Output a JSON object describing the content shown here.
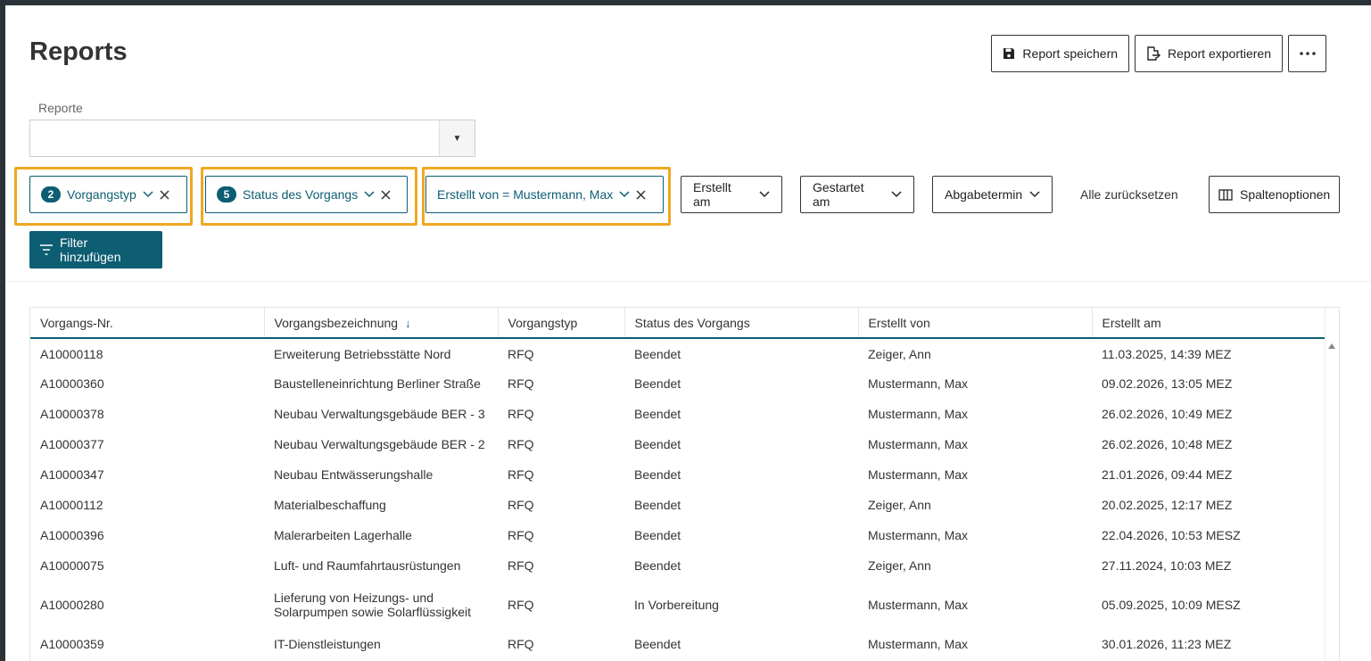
{
  "page": {
    "title": "Reports",
    "actions": {
      "save_label": "Report speichern",
      "export_label": "Report exportieren"
    }
  },
  "report_select": {
    "label": "Reporte",
    "value": ""
  },
  "filters": {
    "active": [
      {
        "count": "2",
        "label": "Vorgangstyp"
      },
      {
        "count": "5",
        "label": "Status des Vorgangs"
      },
      {
        "label": "Erstellt von = Mustermann, Max"
      }
    ],
    "inactive": [
      "Erstellt am",
      "Gestartet am",
      "Abgabetermin"
    ],
    "reset_label": "Alle zurücksetzen",
    "column_options_label": "Spaltenoptionen",
    "add_filter_label": "Filter hinzufügen"
  },
  "table": {
    "columns": [
      "Vorgangs-Nr.",
      "Vorgangsbezeichnung",
      "Vorgangstyp",
      "Status des Vorgangs",
      "Erstellt von",
      "Erstellt am"
    ],
    "sorted_column": "Vorgangsbezeichnung",
    "rows": [
      [
        "A10000118",
        "Erweiterung Betriebsstätte Nord",
        "RFQ",
        "Beendet",
        "Zeiger, Ann",
        "11.03.2025, 14:39 MEZ"
      ],
      [
        "A10000360",
        "Baustelleneinrichtung Berliner Straße",
        "RFQ",
        "Beendet",
        "Mustermann, Max",
        "09.02.2026, 13:05 MEZ"
      ],
      [
        "A10000378",
        "Neubau Verwaltungsgebäude BER - 3",
        "RFQ",
        "Beendet",
        "Mustermann, Max",
        "26.02.2026, 10:49 MEZ"
      ],
      [
        "A10000377",
        "Neubau Verwaltungsgebäude BER - 2",
        "RFQ",
        "Beendet",
        "Mustermann, Max",
        "26.02.2026, 10:48 MEZ"
      ],
      [
        "A10000347",
        "Neubau Entwässerungshalle",
        "RFQ",
        "Beendet",
        "Mustermann, Max",
        "21.01.2026, 09:44 MEZ"
      ],
      [
        "A10000112",
        "Materialbeschaffung",
        "RFQ",
        "Beendet",
        "Zeiger, Ann",
        "20.02.2025, 12:17 MEZ"
      ],
      [
        "A10000396",
        "Malerarbeiten Lagerhalle",
        "RFQ",
        "Beendet",
        "Mustermann, Max",
        "22.04.2026, 10:53 MESZ"
      ],
      [
        "A10000075",
        "Luft- und Raumfahrtausrüstungen",
        "RFQ",
        "Beendet",
        "Zeiger, Ann",
        "27.11.2024, 10:03 MEZ"
      ],
      [
        "A10000280",
        "Lieferung von Heizungs- und Solarpumpen sowie Solarflüssigkeit",
        "RFQ",
        "In Vorbereitung",
        "Mustermann, Max",
        "05.09.2025, 10:09 MESZ"
      ],
      [
        "A10000359",
        "IT-Dienstleistungen",
        "RFQ",
        "Beendet",
        "Mustermann, Max",
        "30.01.2026, 11:23 MEZ"
      ]
    ]
  }
}
